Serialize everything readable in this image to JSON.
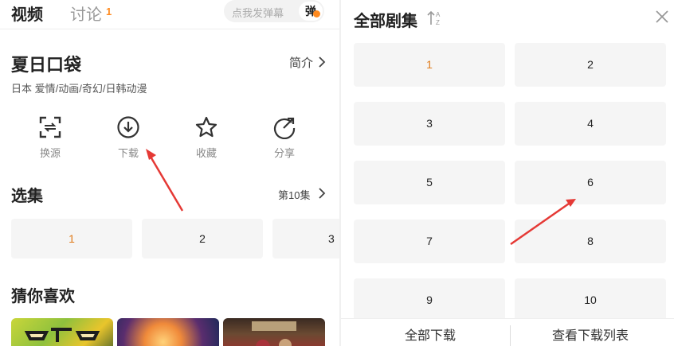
{
  "left": {
    "tabs": {
      "video": "视频",
      "discussion": "讨论",
      "discussion_count": "1"
    },
    "danmu": {
      "placeholder": "点我发弹幕",
      "button": "弹"
    },
    "show": {
      "title": "夏日口袋",
      "intro": "简介",
      "meta": "日本  爱情/动画/奇幻/日韩动漫"
    },
    "actions": [
      {
        "label": "换源",
        "icon": "switch-source-icon"
      },
      {
        "label": "下载",
        "icon": "download-icon"
      },
      {
        "label": "收藏",
        "icon": "star-icon"
      },
      {
        "label": "分享",
        "icon": "share-icon"
      }
    ],
    "episodes": {
      "title": "选集",
      "more": "第10集",
      "items": [
        "1",
        "2",
        "3"
      ],
      "active": "1"
    },
    "guess": {
      "title": "猜你喜欢"
    }
  },
  "right": {
    "title": "全部剧集",
    "episodes": [
      "1",
      "2",
      "3",
      "4",
      "5",
      "6",
      "7",
      "8",
      "9",
      "10"
    ],
    "active": "1",
    "download_all": "全部下载",
    "view_downloads": "查看下载列表"
  },
  "colors": {
    "accent": "#ff8a1f",
    "active_episode": "#e07b1a",
    "annotation_arrow": "#e53935"
  }
}
